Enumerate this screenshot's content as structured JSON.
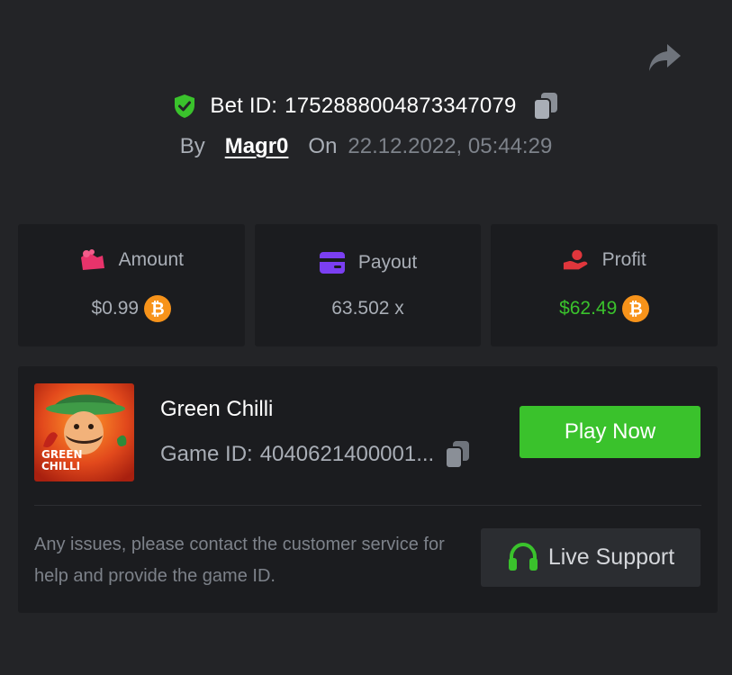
{
  "header": {
    "bet_label": "Bet ID:",
    "bet_id": "1752888004873347079",
    "by_label": "By",
    "username": "Magr0",
    "on_label": "On",
    "date": "22.12.2022, 05:44:29"
  },
  "stats": {
    "amount": {
      "label": "Amount",
      "value": "$0.99"
    },
    "payout": {
      "label": "Payout",
      "value": "63.502 x"
    },
    "profit": {
      "label": "Profit",
      "value": "$62.49"
    }
  },
  "game": {
    "title": "Green Chilli",
    "id_label": "Game ID:",
    "id_value": "4040621400001...",
    "thumb_line1": "GREEN",
    "thumb_line2": "CHILLI",
    "play_label": "Play Now"
  },
  "support": {
    "help_text": "Any issues, please contact the customer service for help and provide the game ID.",
    "button_label": "Live Support"
  },
  "colors": {
    "background": "#232427",
    "card": "#1b1c1f",
    "accent_green": "#3ac22c",
    "amount_icon": "#e8336b",
    "payout_icon": "#7b3ff2",
    "profit_icon": "#e0363c",
    "bitcoin": "#f7931a"
  },
  "icons": [
    "share-icon",
    "shield-check-icon",
    "copy-icon",
    "bag-icon",
    "wallet-icon",
    "hand-coin-icon",
    "bitcoin-icon",
    "headset-icon"
  ]
}
